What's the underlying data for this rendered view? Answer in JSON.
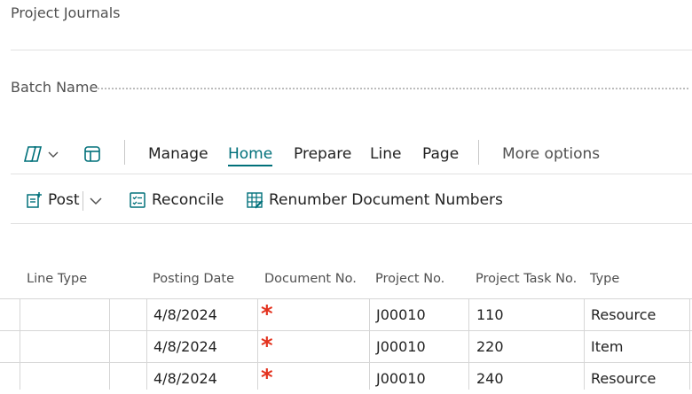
{
  "page": {
    "title": "Project Journals"
  },
  "batch": {
    "label": "Batch Name",
    "value": ""
  },
  "action_bar": {
    "manage": "Manage",
    "home": "Home",
    "prepare": "Prepare",
    "line": "Line",
    "page": "Page",
    "more_options": "More options",
    "icons": [
      "copilot-icon",
      "chevron-down-icon",
      "page-layout-icon"
    ]
  },
  "toolbar": {
    "post": "Post",
    "reconcile": "Reconcile",
    "renumber": "Renumber Document Numbers",
    "icons": [
      "post-icon",
      "chevron-down-icon",
      "reconcile-icon",
      "renumber-icon"
    ]
  },
  "table": {
    "columns": [
      "Line Type",
      "Posting Date",
      "Document No.",
      "Project No.",
      "Project Task No.",
      "Type"
    ],
    "rows": [
      {
        "line_type": "",
        "posting_date": "4/8/2024",
        "document_no": "*",
        "project_no": "J00010",
        "task_no": "110",
        "type": "Resource"
      },
      {
        "line_type": "",
        "posting_date": "4/8/2024",
        "document_no": "*",
        "project_no": "J00010",
        "task_no": "220",
        "type": "Item"
      },
      {
        "line_type": "",
        "posting_date": "4/8/2024",
        "document_no": "*",
        "project_no": "J00010",
        "task_no": "240",
        "type": "Resource"
      }
    ]
  },
  "colors": {
    "accent": "#00707a",
    "required": "#e3321e"
  }
}
